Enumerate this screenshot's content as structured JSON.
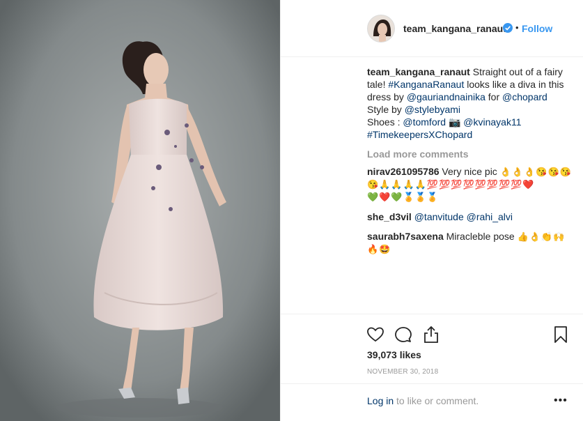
{
  "header": {
    "username": "team_kangana_ranaut",
    "separator": "•",
    "follow_label": "Follow"
  },
  "caption": {
    "username": "team_kangana_ranaut",
    "line1_text": " Straight out of a fairy",
    "line2_prefix": "tale! ",
    "hashtag1": "#KanganaRanaut",
    "line2_suffix": " looks like a diva in this",
    "line3_prefix": "dress by ",
    "mention1": "@gauriandnainika",
    "line3_mid": " for ",
    "mention2": "@chopard",
    "line4_prefix": "Style by ",
    "mention3": "@stylebyami",
    "line5_prefix": "Shoes : ",
    "mention4": "@tomford",
    "camera_emoji": " 📷 ",
    "mention5": "@kvinayak11",
    "hashtag2": "#TimekeepersXChopard"
  },
  "load_more": "Load more comments",
  "comments": [
    {
      "username": "nirav261095786",
      "text": " Very nice pic ",
      "emoji1": "👌👌👌😘😘😘",
      "emoji2": "😘🙏🙏🙏🙏💯💯💯💯💯💯💯💯❤️",
      "emoji3": "💚❤️💚🏅🏅🏅"
    },
    {
      "username": "she_d3vil",
      "mention_a": "@tanvitude",
      "mention_b": "@rahi_alvi"
    },
    {
      "username": "saurabh7saxena",
      "text": " Miracleble pose ",
      "emoji1": "👍👌👏🙌",
      "emoji2": "🔥🤩"
    }
  ],
  "actions": {
    "icons": [
      "heart-icon",
      "comment-icon",
      "share-icon",
      "bookmark-icon"
    ]
  },
  "likes": "39,073 likes",
  "date": "NOVEMBER 30, 2018",
  "login": {
    "link": "Log in",
    "text": " to like or comment."
  },
  "more_label": "•••",
  "colors": {
    "link": "#003569",
    "follow": "#3897f0",
    "muted": "#999999",
    "verified": "#3897f0"
  }
}
